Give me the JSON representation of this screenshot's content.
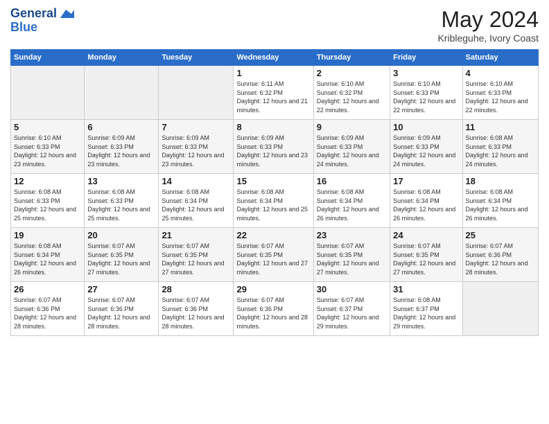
{
  "header": {
    "logo_line1": "General",
    "logo_line2": "Blue",
    "month_title": "May 2024",
    "location": "Kribleguhe, Ivory Coast"
  },
  "weekdays": [
    "Sunday",
    "Monday",
    "Tuesday",
    "Wednesday",
    "Thursday",
    "Friday",
    "Saturday"
  ],
  "weeks": [
    [
      {
        "day": "",
        "empty": true
      },
      {
        "day": "",
        "empty": true
      },
      {
        "day": "",
        "empty": true
      },
      {
        "day": "1",
        "sunrise": "Sunrise: 6:11 AM",
        "sunset": "Sunset: 6:32 PM",
        "daylight": "Daylight: 12 hours and 21 minutes."
      },
      {
        "day": "2",
        "sunrise": "Sunrise: 6:10 AM",
        "sunset": "Sunset: 6:32 PM",
        "daylight": "Daylight: 12 hours and 22 minutes."
      },
      {
        "day": "3",
        "sunrise": "Sunrise: 6:10 AM",
        "sunset": "Sunset: 6:33 PM",
        "daylight": "Daylight: 12 hours and 22 minutes."
      },
      {
        "day": "4",
        "sunrise": "Sunrise: 6:10 AM",
        "sunset": "Sunset: 6:33 PM",
        "daylight": "Daylight: 12 hours and 22 minutes."
      }
    ],
    [
      {
        "day": "5",
        "sunrise": "Sunrise: 6:10 AM",
        "sunset": "Sunset: 6:33 PM",
        "daylight": "Daylight: 12 hours and 23 minutes."
      },
      {
        "day": "6",
        "sunrise": "Sunrise: 6:09 AM",
        "sunset": "Sunset: 6:33 PM",
        "daylight": "Daylight: 12 hours and 23 minutes."
      },
      {
        "day": "7",
        "sunrise": "Sunrise: 6:09 AM",
        "sunset": "Sunset: 6:33 PM",
        "daylight": "Daylight: 12 hours and 23 minutes."
      },
      {
        "day": "8",
        "sunrise": "Sunrise: 6:09 AM",
        "sunset": "Sunset: 6:33 PM",
        "daylight": "Daylight: 12 hours and 23 minutes."
      },
      {
        "day": "9",
        "sunrise": "Sunrise: 6:09 AM",
        "sunset": "Sunset: 6:33 PM",
        "daylight": "Daylight: 12 hours and 24 minutes."
      },
      {
        "day": "10",
        "sunrise": "Sunrise: 6:09 AM",
        "sunset": "Sunset: 6:33 PM",
        "daylight": "Daylight: 12 hours and 24 minutes."
      },
      {
        "day": "11",
        "sunrise": "Sunrise: 6:08 AM",
        "sunset": "Sunset: 6:33 PM",
        "daylight": "Daylight: 12 hours and 24 minutes."
      }
    ],
    [
      {
        "day": "12",
        "sunrise": "Sunrise: 6:08 AM",
        "sunset": "Sunset: 6:33 PM",
        "daylight": "Daylight: 12 hours and 25 minutes."
      },
      {
        "day": "13",
        "sunrise": "Sunrise: 6:08 AM",
        "sunset": "Sunset: 6:33 PM",
        "daylight": "Daylight: 12 hours and 25 minutes."
      },
      {
        "day": "14",
        "sunrise": "Sunrise: 6:08 AM",
        "sunset": "Sunset: 6:34 PM",
        "daylight": "Daylight: 12 hours and 25 minutes."
      },
      {
        "day": "15",
        "sunrise": "Sunrise: 6:08 AM",
        "sunset": "Sunset: 6:34 PM",
        "daylight": "Daylight: 12 hours and 25 minutes."
      },
      {
        "day": "16",
        "sunrise": "Sunrise: 6:08 AM",
        "sunset": "Sunset: 6:34 PM",
        "daylight": "Daylight: 12 hours and 26 minutes."
      },
      {
        "day": "17",
        "sunrise": "Sunrise: 6:08 AM",
        "sunset": "Sunset: 6:34 PM",
        "daylight": "Daylight: 12 hours and 26 minutes."
      },
      {
        "day": "18",
        "sunrise": "Sunrise: 6:08 AM",
        "sunset": "Sunset: 6:34 PM",
        "daylight": "Daylight: 12 hours and 26 minutes."
      }
    ],
    [
      {
        "day": "19",
        "sunrise": "Sunrise: 6:08 AM",
        "sunset": "Sunset: 6:34 PM",
        "daylight": "Daylight: 12 hours and 26 minutes."
      },
      {
        "day": "20",
        "sunrise": "Sunrise: 6:07 AM",
        "sunset": "Sunset: 6:35 PM",
        "daylight": "Daylight: 12 hours and 27 minutes."
      },
      {
        "day": "21",
        "sunrise": "Sunrise: 6:07 AM",
        "sunset": "Sunset: 6:35 PM",
        "daylight": "Daylight: 12 hours and 27 minutes."
      },
      {
        "day": "22",
        "sunrise": "Sunrise: 6:07 AM",
        "sunset": "Sunset: 6:35 PM",
        "daylight": "Daylight: 12 hours and 27 minutes."
      },
      {
        "day": "23",
        "sunrise": "Sunrise: 6:07 AM",
        "sunset": "Sunset: 6:35 PM",
        "daylight": "Daylight: 12 hours and 27 minutes."
      },
      {
        "day": "24",
        "sunrise": "Sunrise: 6:07 AM",
        "sunset": "Sunset: 6:35 PM",
        "daylight": "Daylight: 12 hours and 27 minutes."
      },
      {
        "day": "25",
        "sunrise": "Sunrise: 6:07 AM",
        "sunset": "Sunset: 6:36 PM",
        "daylight": "Daylight: 12 hours and 28 minutes."
      }
    ],
    [
      {
        "day": "26",
        "sunrise": "Sunrise: 6:07 AM",
        "sunset": "Sunset: 6:36 PM",
        "daylight": "Daylight: 12 hours and 28 minutes."
      },
      {
        "day": "27",
        "sunrise": "Sunrise: 6:07 AM",
        "sunset": "Sunset: 6:36 PM",
        "daylight": "Daylight: 12 hours and 28 minutes."
      },
      {
        "day": "28",
        "sunrise": "Sunrise: 6:07 AM",
        "sunset": "Sunset: 6:36 PM",
        "daylight": "Daylight: 12 hours and 28 minutes."
      },
      {
        "day": "29",
        "sunrise": "Sunrise: 6:07 AM",
        "sunset": "Sunset: 6:36 PM",
        "daylight": "Daylight: 12 hours and 28 minutes."
      },
      {
        "day": "30",
        "sunrise": "Sunrise: 6:07 AM",
        "sunset": "Sunset: 6:37 PM",
        "daylight": "Daylight: 12 hours and 29 minutes."
      },
      {
        "day": "31",
        "sunrise": "Sunrise: 6:08 AM",
        "sunset": "Sunset: 6:37 PM",
        "daylight": "Daylight: 12 hours and 29 minutes."
      },
      {
        "day": "",
        "empty": true
      }
    ]
  ]
}
